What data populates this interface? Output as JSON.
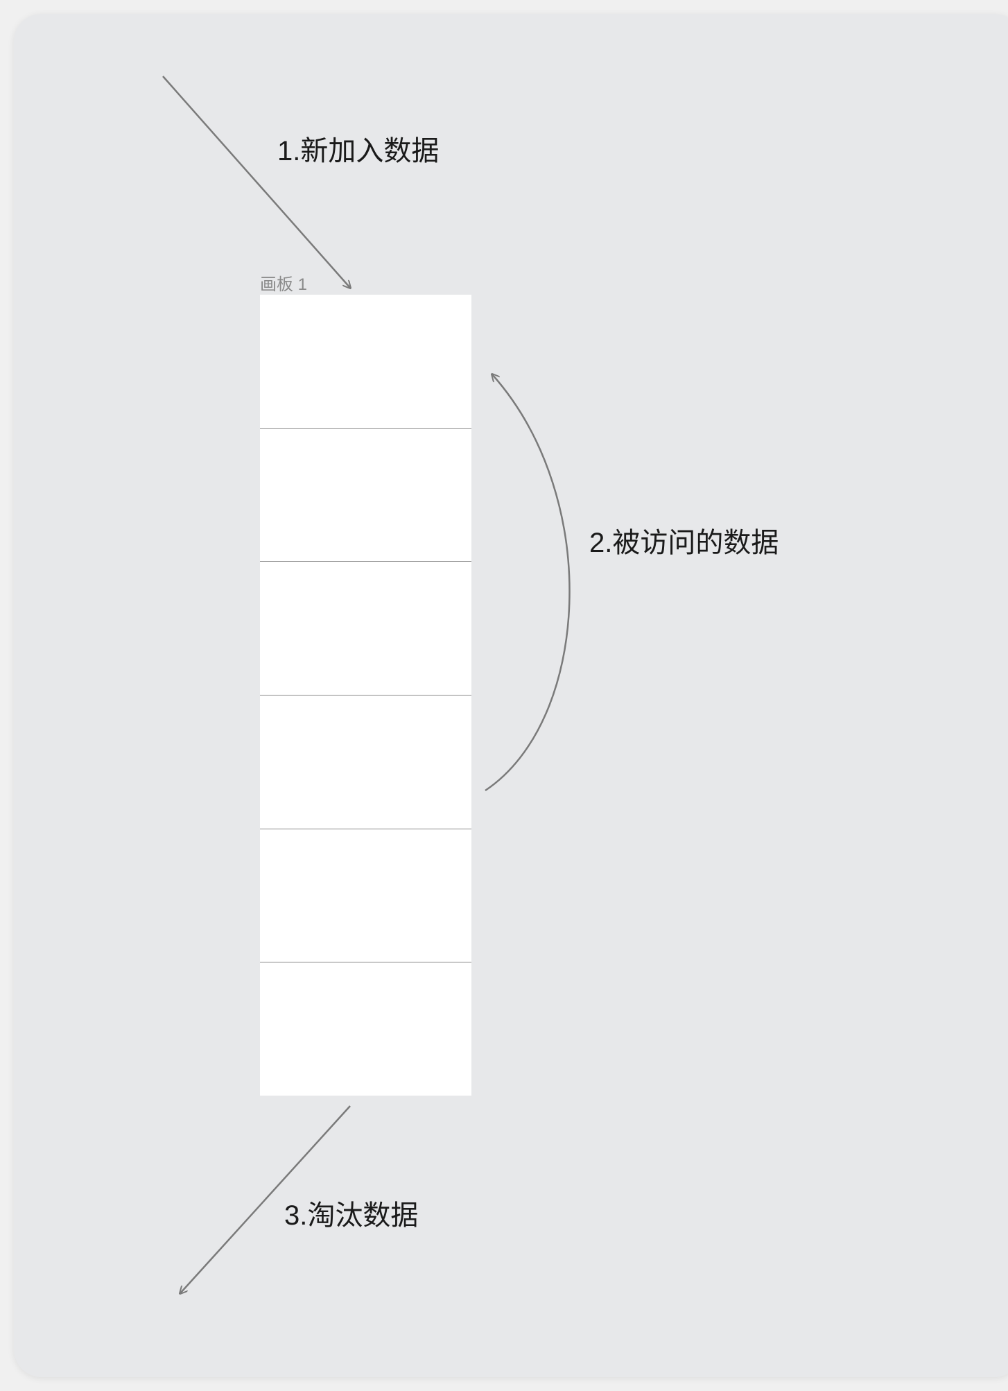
{
  "artboard_label": "画板 1",
  "labels": {
    "new_data": "1.新加入数据",
    "accessed_data": "2.被访问的数据",
    "evicted_data": "3.淘汰数据"
  },
  "stack": {
    "cells": 6
  },
  "colors": {
    "canvas_bg": "#e7e8ea",
    "cell_bg": "#ffffff",
    "cell_border": "#888888",
    "text": "#1a1a1a",
    "arrow": "#7a7a7a",
    "label_muted": "#8a8a8a"
  }
}
